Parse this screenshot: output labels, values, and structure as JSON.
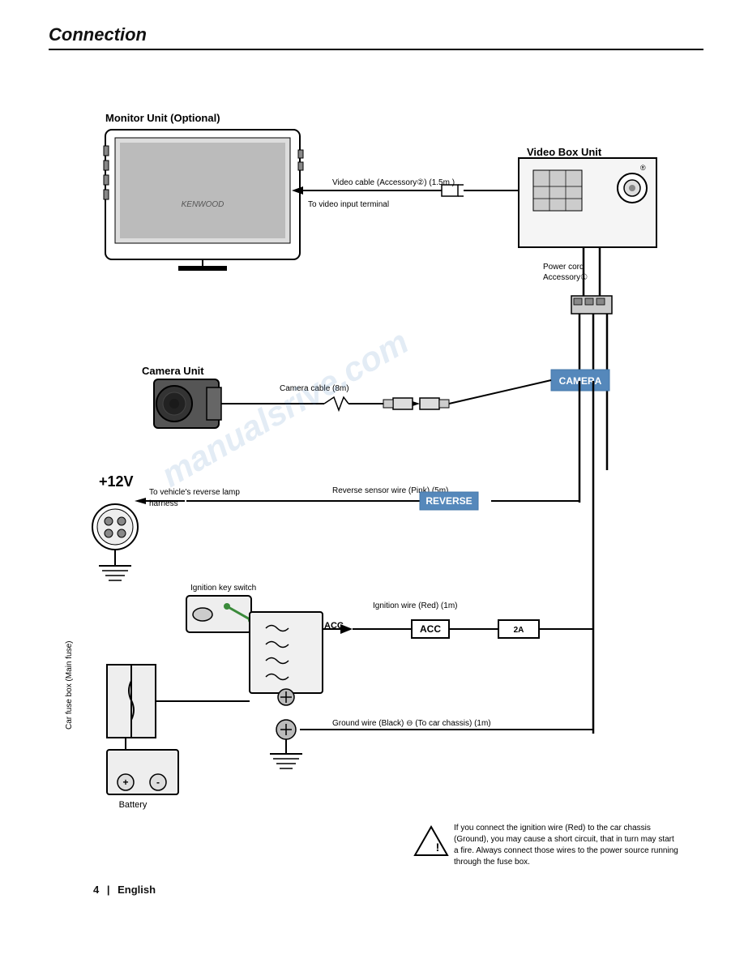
{
  "header": {
    "title": "Connection",
    "line": true
  },
  "sections": {
    "monitor_unit": {
      "label": "Monitor Unit (Optional)"
    },
    "video_box_unit": {
      "label": "Video Box Unit"
    },
    "camera_unit": {
      "label": "Camera Unit"
    },
    "plus12v": {
      "label": "+12V"
    }
  },
  "annotations": {
    "video_cable": "Video cable (Accessory②) (1.5m )",
    "to_video_input": "To video input terminal",
    "power_cord": "Power cord\nAccessory①",
    "camera_cable": "Camera cable (8m)",
    "camera_tag": "CAMERA",
    "reverse_wire": "Reverse sensor wire (Pink) (5m)",
    "reverse_tag": "REVERSE",
    "to_reverse_lamp": "To vehicle's reverse lamp\nharness",
    "ignition_key_switch": "Ignition key switch",
    "car_fuse_box": "Car fuse box",
    "acc_arrow": "ACC",
    "ignition_wire": "Ignition wire (Red) (1m)",
    "acc_tag": "ACC",
    "fuse_2a": "2A",
    "car_fuse_box_main": "Car fuse box (Main fuse)",
    "ground_wire": "Ground wire (Black) ⊖ (To car chassis) (1m)",
    "battery_label": "Battery"
  },
  "warning": {
    "text": "If you connect the ignition wire (Red) to the car chassis (Ground), you may cause a short circuit, that in turn may start a fire. Always connect those wires to the power source running through the fuse box."
  },
  "footer": {
    "page_number": "4",
    "language": "English"
  },
  "watermark": "manualsrive.com"
}
